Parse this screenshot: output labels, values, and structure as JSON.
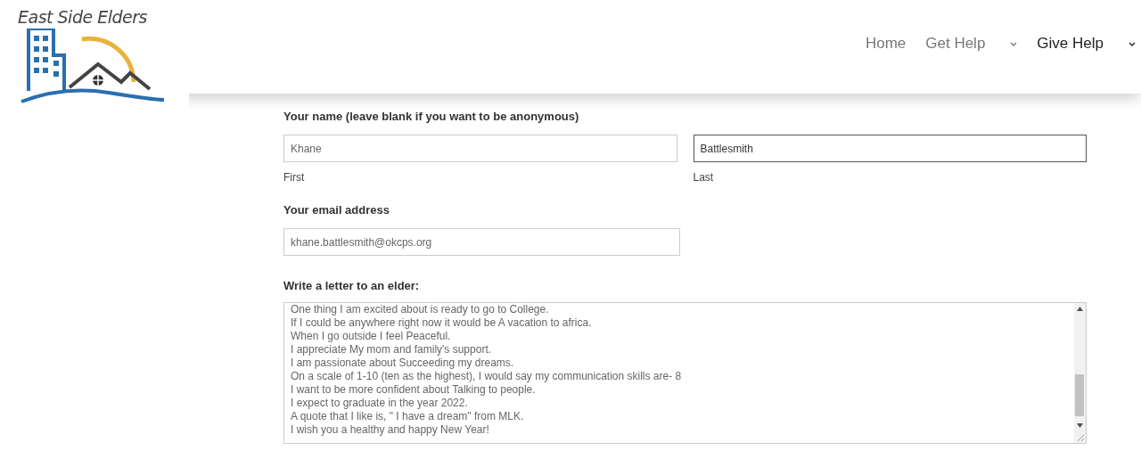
{
  "logo": {
    "text": "East Side Elders"
  },
  "nav": [
    {
      "label": "Home",
      "selected": false,
      "dropdown": false
    },
    {
      "label": "Get Help",
      "selected": false,
      "dropdown": true
    },
    {
      "label": "Give Help",
      "selected": true,
      "dropdown": true
    }
  ],
  "form": {
    "name_label": "Your name (leave blank if you want to be anonymous)",
    "name_fields": [
      {
        "value": "Khane",
        "sublabel": "First",
        "focused": false
      },
      {
        "value": "Battlesmith",
        "sublabel": "Last",
        "focused": true
      }
    ],
    "email_label": "Your email address",
    "email_value": "khane.battlesmith@okcps.org",
    "letter_label": "Write a letter to an elder:",
    "letter_lines": [
      "One thing I am excited about is ready to go to College.",
      "If I could be anywhere right now it would be A vacation to africa.",
      "When I go outside I feel Peaceful.",
      "I appreciate My mom and family's support.",
      "I am passionate about Succeeding my dreams.",
      "On a scale of 1-10 (ten as the highest), I would say my communication skills are- 8",
      "I want to be more confident about Talking to people.",
      "I expect to graduate in the year 2022.",
      "A quote that I like is, \" I have a dream\" from MLK.",
      "I wish you a healthy and happy New Year!"
    ]
  }
}
